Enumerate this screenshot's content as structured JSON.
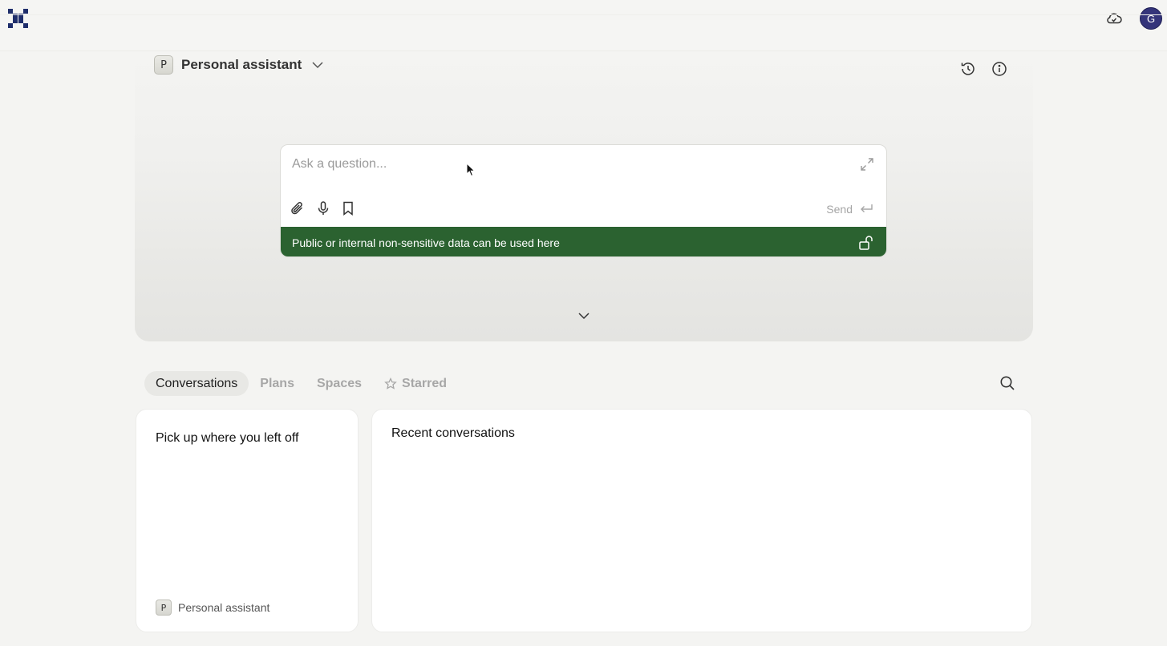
{
  "header": {
    "avatar_initial": "G"
  },
  "hero": {
    "assistant_badge": "P",
    "assistant_name": "Personal assistant"
  },
  "composer": {
    "placeholder": "Ask a question...",
    "value": "",
    "send_label": "Send",
    "notice": "Public or internal non-sensitive data can be used here",
    "notice_color": "#2b6230"
  },
  "tabs": [
    {
      "label": "Conversations",
      "active": true
    },
    {
      "label": "Plans",
      "active": false
    },
    {
      "label": "Spaces",
      "active": false
    },
    {
      "label": "Starred",
      "active": false
    }
  ],
  "cards": {
    "left": {
      "title": "Pick up where you left off",
      "badge": "P",
      "assistant": "Personal assistant"
    },
    "right": {
      "title": "Recent conversations"
    }
  },
  "colors": {
    "brand": "#1f2e6b",
    "avatar_bg": "#34347a"
  },
  "icons": [
    "logo-icon",
    "cloud-icon",
    "history-icon",
    "info-icon",
    "expand-icon",
    "paperclip-icon",
    "microphone-icon",
    "bookmark-icon",
    "enter-icon",
    "unlock-icon",
    "chevron-down-icon",
    "star-icon",
    "search-icon"
  ]
}
